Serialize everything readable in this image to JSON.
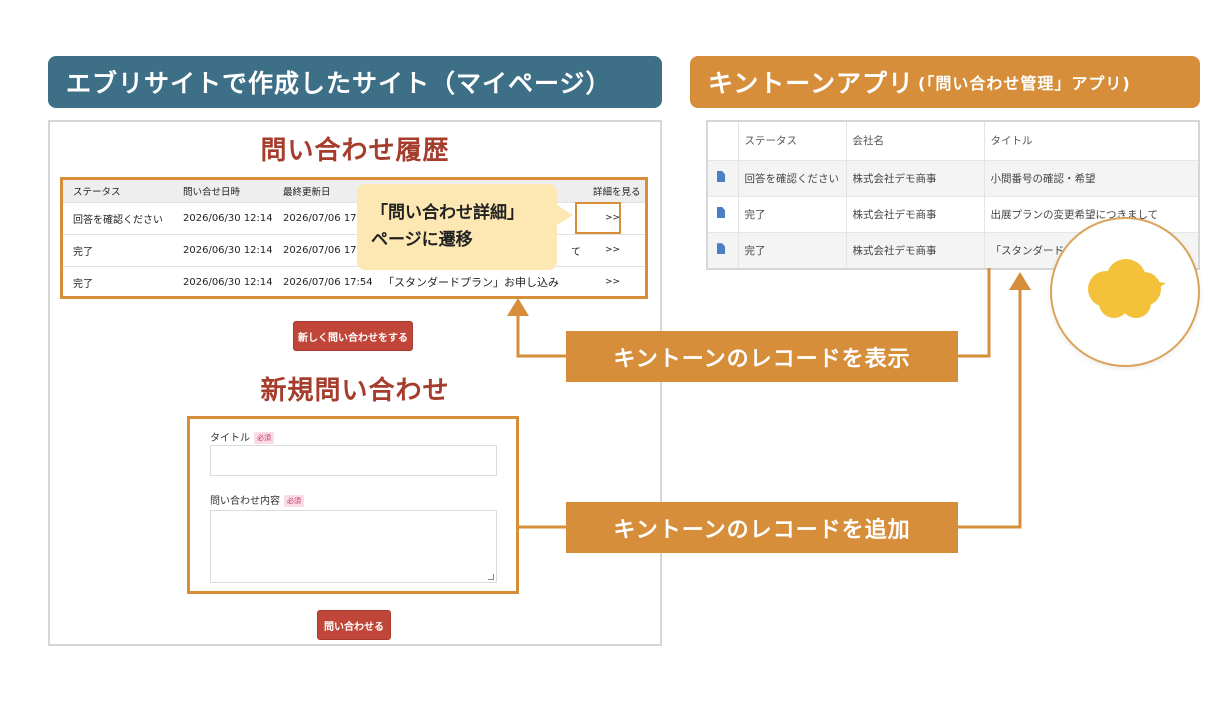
{
  "headers": {
    "site": "エブリサイトで作成したサイト（マイページ）",
    "kintone": "キントーンアプリ",
    "kintone_sub": "(「問い合わせ管理」アプリ)"
  },
  "site": {
    "history_title": "問い合わせ履歴",
    "columns": [
      "ステータス",
      "問い合せ日時",
      "最終更新日",
      "",
      "詳細を見る"
    ],
    "rows": [
      {
        "status": "回答を確認ください",
        "date": "2026/06/30 12:14",
        "updated": "2026/07/06 17:54",
        "title": "",
        "arrow": ">>"
      },
      {
        "status": "完了",
        "date": "2026/06/30 12:14",
        "updated": "2026/07/06 17:54",
        "title": "て",
        "arrow": ">>"
      },
      {
        "status": "完了",
        "date": "2026/06/30 12:14",
        "updated": "2026/07/06 17:54",
        "title": "「スタンダードプラン」お申し込み",
        "arrow": ">>"
      }
    ],
    "callout_line1": "「問い合わせ詳細」",
    "callout_line2": "ページに遷移",
    "new_button": "新しく問い合わせをする",
    "new_title": "新規問い合わせ",
    "form": {
      "title_label": "タイトル",
      "content_label": "問い合わせ内容",
      "required": "必須"
    },
    "submit_button": "問い合わせる"
  },
  "kintone": {
    "columns": [
      "",
      "ステータス",
      "会社名",
      "タイトル"
    ],
    "rows": [
      {
        "status": "回答を確認ください",
        "company": "株式会社デモ商事",
        "title": "小間番号の確認・希望"
      },
      {
        "status": "完了",
        "company": "株式会社デモ商事",
        "title": "出展プランの変更希望につきまして"
      },
      {
        "status": "完了",
        "company": "株式会社デモ商事",
        "title": "「スタンダード"
      }
    ]
  },
  "flows": {
    "show": "キントーンのレコードを表示",
    "add": "キントーンのレコードを追加"
  },
  "colors": {
    "header_site": "#3d6f87",
    "accent_orange": "#d68e3a",
    "title_red": "#a63c2c",
    "button_red": "#c1463a",
    "callout_yellow": "#fde8b4",
    "cloud_yellow": "#f3c13a"
  },
  "icons": [
    "document-icon",
    "kintone-cloud-icon"
  ]
}
